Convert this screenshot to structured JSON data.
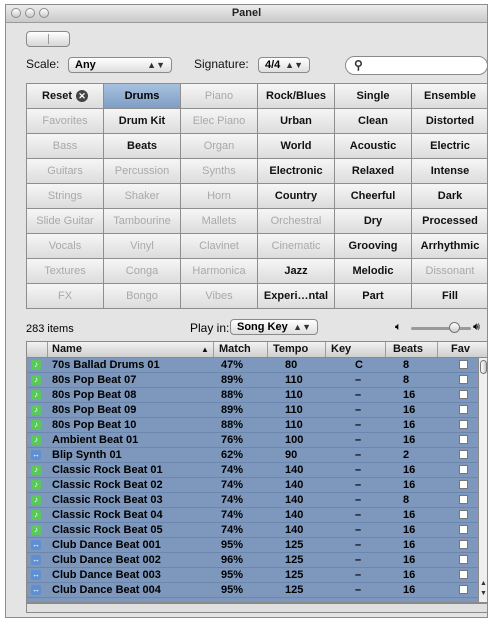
{
  "window": {
    "title": "Panel"
  },
  "toolbar": {
    "scale_label": "Scale:",
    "scale_value": "Any",
    "signature_label": "Signature:",
    "signature_value": "4/4",
    "search_placeholder": ""
  },
  "grid": {
    "rows": [
      [
        "Reset",
        "Drums",
        "Piano",
        "Rock/Blues",
        "Single",
        "Ensemble"
      ],
      [
        "Favorites",
        "Drum Kit",
        "Elec Piano",
        "Urban",
        "Clean",
        "Distorted"
      ],
      [
        "Bass",
        "Beats",
        "Organ",
        "World",
        "Acoustic",
        "Electric"
      ],
      [
        "Guitars",
        "Percussion",
        "Synths",
        "Electronic",
        "Relaxed",
        "Intense"
      ],
      [
        "Strings",
        "Shaker",
        "Horn",
        "Country",
        "Cheerful",
        "Dark"
      ],
      [
        "Slide Guitar",
        "Tambourine",
        "Mallets",
        "Orchestral",
        "Dry",
        "Processed"
      ],
      [
        "Vocals",
        "Vinyl",
        "Clavinet",
        "Cinematic",
        "Grooving",
        "Arrhythmic"
      ],
      [
        "Textures",
        "Conga",
        "Harmonica",
        "Jazz",
        "Melodic",
        "Dissonant"
      ],
      [
        "FX",
        "Bongo",
        "Vibes",
        "Experi…ntal",
        "Part",
        "Fill"
      ]
    ],
    "dim": [
      [
        0,
        0,
        1,
        0,
        0,
        0
      ],
      [
        1,
        0,
        1,
        0,
        0,
        0
      ],
      [
        1,
        0,
        1,
        0,
        0,
        0
      ],
      [
        1,
        1,
        1,
        0,
        0,
        0
      ],
      [
        1,
        1,
        1,
        0,
        0,
        0
      ],
      [
        1,
        1,
        1,
        1,
        0,
        0
      ],
      [
        1,
        1,
        1,
        1,
        0,
        0
      ],
      [
        1,
        1,
        1,
        0,
        0,
        1
      ],
      [
        1,
        1,
        1,
        0,
        0,
        0
      ]
    ],
    "selected": "Drums"
  },
  "status": {
    "items_count": "283 items",
    "play_in_label": "Play in:",
    "play_in_value": "Song Key"
  },
  "table": {
    "headers": [
      "Name",
      "Match",
      "Tempo",
      "Key",
      "Beats",
      "Fav"
    ],
    "rows": [
      {
        "type": "green",
        "name": "70s Ballad Drums 01",
        "match": "47%",
        "tempo": "80",
        "key": "C",
        "beats": "8"
      },
      {
        "type": "green",
        "name": "80s Pop Beat 07",
        "match": "89%",
        "tempo": "110",
        "key": "–",
        "beats": "8"
      },
      {
        "type": "green",
        "name": "80s Pop Beat 08",
        "match": "88%",
        "tempo": "110",
        "key": "–",
        "beats": "16"
      },
      {
        "type": "green",
        "name": "80s Pop Beat 09",
        "match": "89%",
        "tempo": "110",
        "key": "–",
        "beats": "16"
      },
      {
        "type": "green",
        "name": "80s Pop Beat 10",
        "match": "88%",
        "tempo": "110",
        "key": "–",
        "beats": "16"
      },
      {
        "type": "green",
        "name": "Ambient Beat 01",
        "match": "76%",
        "tempo": "100",
        "key": "–",
        "beats": "16"
      },
      {
        "type": "blue",
        "name": "Blip Synth 01",
        "match": "62%",
        "tempo": "90",
        "key": "–",
        "beats": "2"
      },
      {
        "type": "green",
        "name": "Classic Rock Beat 01",
        "match": "74%",
        "tempo": "140",
        "key": "–",
        "beats": "16"
      },
      {
        "type": "green",
        "name": "Classic Rock Beat 02",
        "match": "74%",
        "tempo": "140",
        "key": "–",
        "beats": "16"
      },
      {
        "type": "green",
        "name": "Classic Rock Beat 03",
        "match": "74%",
        "tempo": "140",
        "key": "–",
        "beats": "8"
      },
      {
        "type": "green",
        "name": "Classic Rock Beat 04",
        "match": "74%",
        "tempo": "140",
        "key": "–",
        "beats": "16"
      },
      {
        "type": "green",
        "name": "Classic Rock Beat 05",
        "match": "74%",
        "tempo": "140",
        "key": "–",
        "beats": "16"
      },
      {
        "type": "blue",
        "name": "Club Dance Beat 001",
        "match": "95%",
        "tempo": "125",
        "key": "–",
        "beats": "16"
      },
      {
        "type": "blue",
        "name": "Club Dance Beat 002",
        "match": "96%",
        "tempo": "125",
        "key": "–",
        "beats": "16"
      },
      {
        "type": "blue",
        "name": "Club Dance Beat 003",
        "match": "95%",
        "tempo": "125",
        "key": "–",
        "beats": "16"
      },
      {
        "type": "blue",
        "name": "Club Dance Beat 004",
        "match": "95%",
        "tempo": "125",
        "key": "–",
        "beats": "16"
      }
    ]
  },
  "colors": {
    "selected_cell": "#8fabd0",
    "table_bg": "#7d98bc",
    "green_icon": "#5ac85a",
    "blue_icon": "#5f8fd0"
  }
}
